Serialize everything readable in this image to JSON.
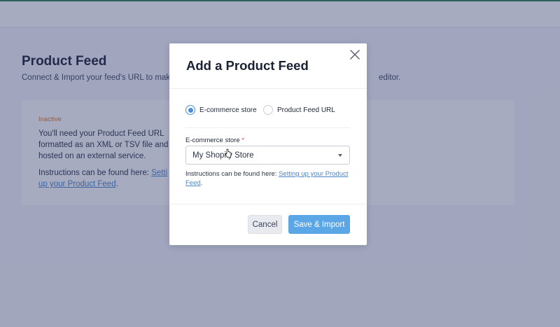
{
  "page": {
    "title": "Product Feed",
    "subtitle_visible": "Connect & Import your feed's URL to mak",
    "subtitle_tail": "editor."
  },
  "card": {
    "status": "Inactive",
    "text": "You'll need your Product Feed URL formatted as an XML or TSV file and hosted on an external service.",
    "instr_prefix": "Instructions can be found here: ",
    "instr_link": "Setti up your Product Feed",
    "instr_suffix": "."
  },
  "modal": {
    "title": "Add a Product Feed",
    "radios": [
      {
        "label": "E-commerce store",
        "checked": true
      },
      {
        "label": "Product Feed URL",
        "checked": false
      }
    ],
    "field_label": "E-commerce store",
    "required_mark": "*",
    "select_value": "My Shopify Store",
    "instructions_prefix": "Instructions can be found here: ",
    "instructions_link": "Setting up your Product Feed",
    "instructions_suffix": ".",
    "cancel_label": "Cancel",
    "save_label": "Save & Import"
  },
  "colors": {
    "overlay": "#2c3668",
    "primary": "#5aa6e6",
    "radio_checked": "#4a8fd6",
    "link": "#4d86c8",
    "status_inactive": "#d9772b"
  },
  "icons": {
    "close": "close-icon",
    "select_caret": "chevron-down-icon",
    "cursor": "hand-cursor-icon"
  }
}
